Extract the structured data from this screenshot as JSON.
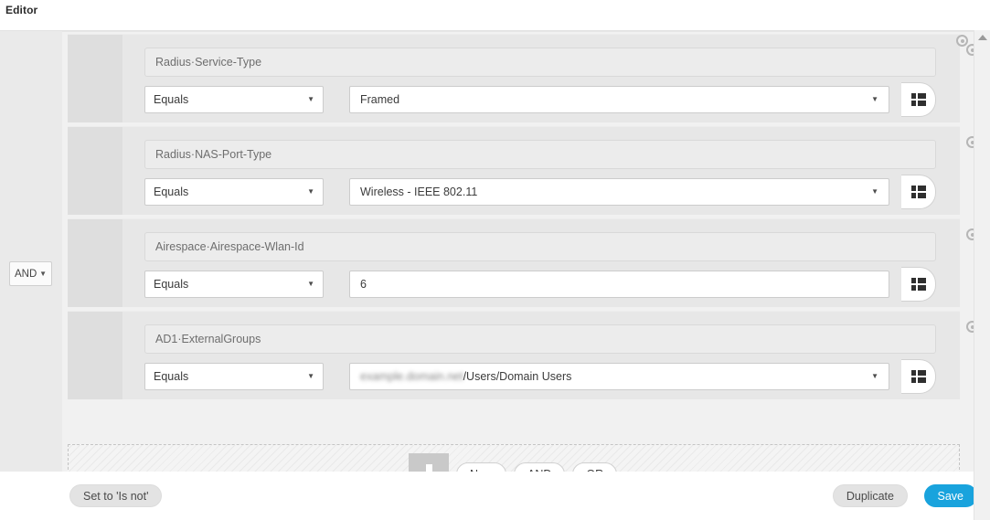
{
  "header": {
    "title": "Editor"
  },
  "logic": {
    "operator": "AND",
    "caret_icon": "chevron-down-icon"
  },
  "conditions": [
    {
      "attribute": "Radius·Service-Type",
      "operator": "Equals",
      "value": "Framed",
      "value_has_dropdown": true,
      "picker_icon": "grid-picker-icon",
      "remove_icon": "remove-circle-icon"
    },
    {
      "attribute": "Radius·NAS-Port-Type",
      "operator": "Equals",
      "value": "Wireless - IEEE 802.11",
      "value_has_dropdown": true,
      "picker_icon": "grid-picker-icon",
      "remove_icon": "remove-circle-icon"
    },
    {
      "attribute": "Airespace·Airespace-Wlan-Id",
      "operator": "Equals",
      "value": "6",
      "value_has_dropdown": false,
      "picker_icon": "grid-picker-icon",
      "remove_icon": "remove-circle-icon"
    },
    {
      "attribute": "AD1·ExternalGroups",
      "operator": "Equals",
      "value_redacted_prefix": "example.domain.net",
      "value_suffix": "/Users/Domain Users",
      "value_has_dropdown": true,
      "picker_icon": "grid-picker-icon",
      "remove_icon": "remove-circle-icon"
    }
  ],
  "drop_zone": {
    "add_icon": "plus-icon",
    "pills": [
      {
        "label": "New"
      },
      {
        "label": "AND"
      },
      {
        "label": "OR"
      }
    ]
  },
  "footer": {
    "set_is_not_label": "Set to 'Is not'",
    "duplicate_label": "Duplicate",
    "save_label": "Save"
  },
  "scrollbar": {
    "up_arrow_icon": "scroll-up-arrow-icon"
  },
  "colors": {
    "accent": "#19a3dd",
    "panel_bg": "#f1f1f1",
    "row_bg": "#e7e7e7",
    "gutter_bg": "#dedede",
    "field_border": "#cccccc",
    "attr_bg": "#ececec"
  }
}
